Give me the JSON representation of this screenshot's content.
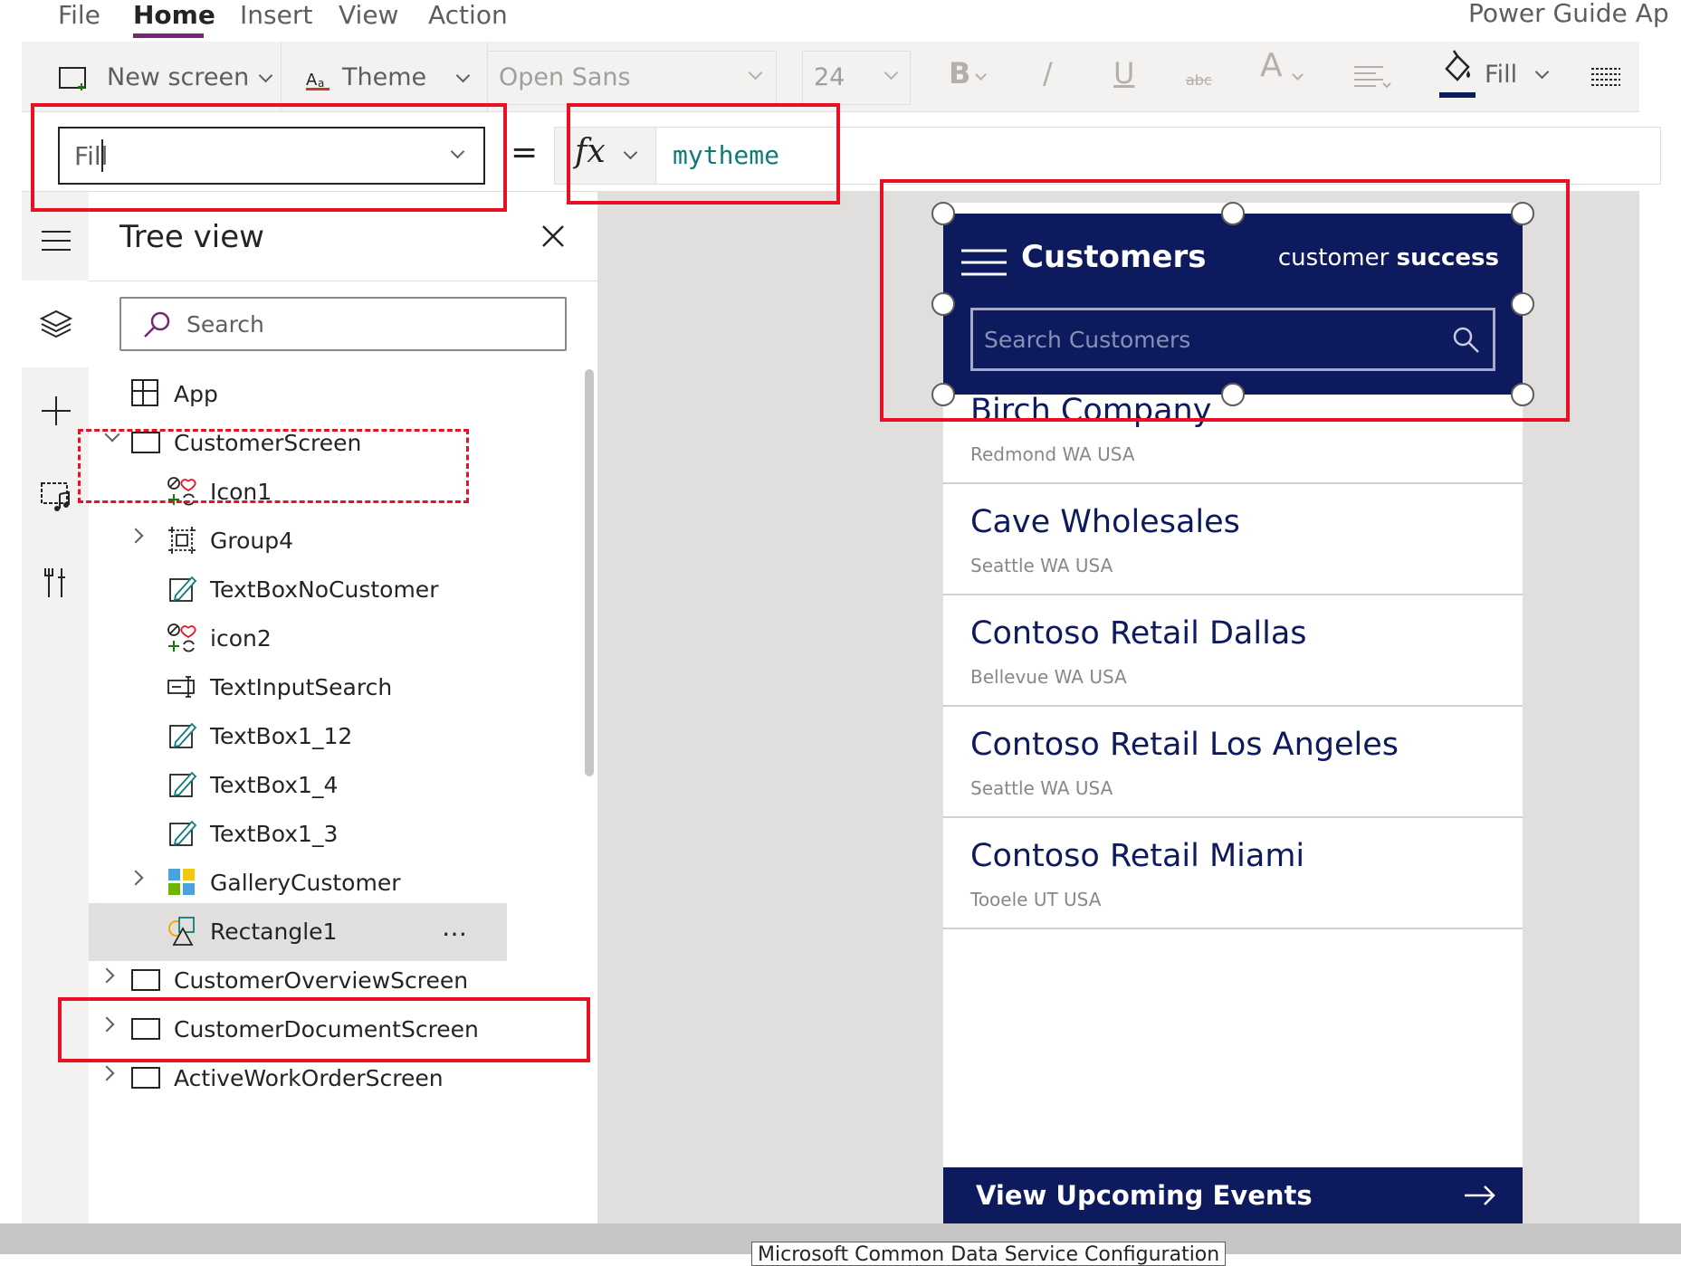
{
  "menu": {
    "items": [
      "File",
      "Home",
      "Insert",
      "View",
      "Action"
    ],
    "active": "Home",
    "app_title": "Power Guide Ap"
  },
  "ribbon": {
    "new_screen": "New screen",
    "theme": "Theme",
    "font": "Open Sans",
    "font_size": "24",
    "bold": "B",
    "italic": "/",
    "underline": "U",
    "strikethrough": "abc",
    "font_color": "A",
    "fill": "Fill"
  },
  "formula": {
    "property": "Fill",
    "equals": "=",
    "fx": "fx",
    "value": "mytheme"
  },
  "tree": {
    "title": "Tree view",
    "search_placeholder": "Search",
    "nodes": [
      {
        "label": "App"
      },
      {
        "label": "CustomerScreen"
      },
      {
        "label": "Icon1"
      },
      {
        "label": "Group4"
      },
      {
        "label": "TextBoxNoCustomer"
      },
      {
        "label": "icon2"
      },
      {
        "label": "TextInputSearch"
      },
      {
        "label": "TextBox1_12"
      },
      {
        "label": "TextBox1_4"
      },
      {
        "label": "TextBox1_3"
      },
      {
        "label": "GalleryCustomer"
      },
      {
        "label": "Rectangle1"
      },
      {
        "label": "CustomerOverviewScreen"
      },
      {
        "label": "CustomerDocumentScreen"
      },
      {
        "label": "ActiveWorkOrderScreen"
      }
    ],
    "more": "…"
  },
  "app_screen": {
    "header_title": "Customers",
    "brand_light": "customer",
    "brand_bold": "success",
    "search_placeholder": "Search Customers",
    "customers": [
      {
        "name": "Birch Company",
        "location": "Redmond WA USA"
      },
      {
        "name": "Cave Wholesales",
        "location": "Seattle WA USA"
      },
      {
        "name": "Contoso Retail Dallas",
        "location": "Bellevue WA USA"
      },
      {
        "name": "Contoso Retail Los Angeles",
        "location": "Seattle WA USA"
      },
      {
        "name": "Contoso Retail Miami",
        "location": "Tooele UT USA"
      }
    ],
    "footer_button": "View Upcoming Events"
  },
  "status": {
    "tooltip": "Microsoft Common Data Service Configuration"
  },
  "colors": {
    "header_navy": "#0e1a5e",
    "accent_purple": "#742774",
    "annotation_red": "#e81123",
    "formula_teal": "#0f7b7b"
  }
}
